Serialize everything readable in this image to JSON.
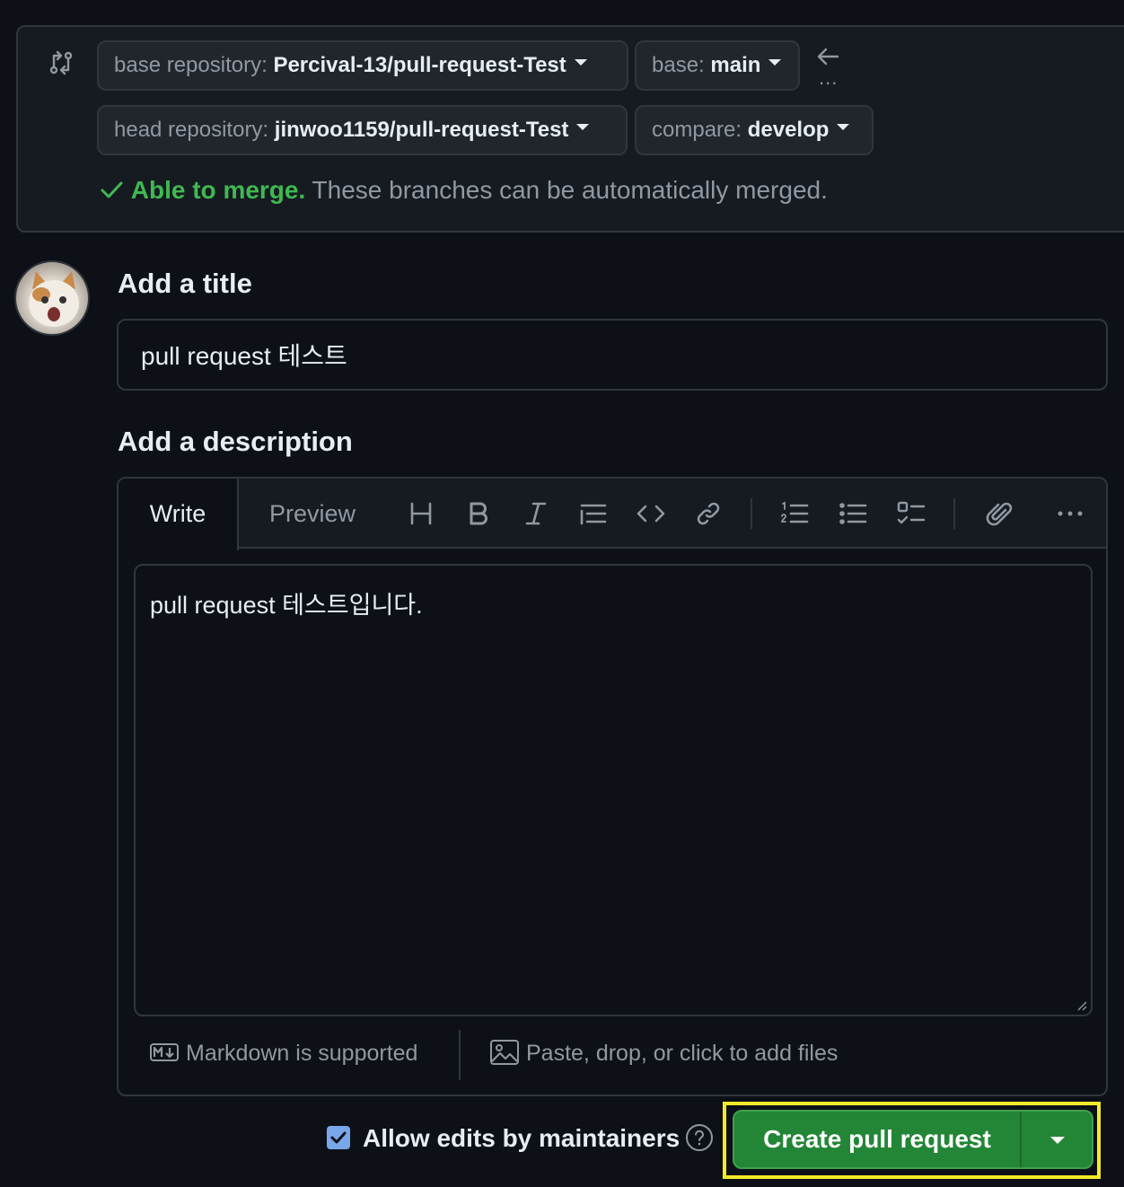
{
  "compare": {
    "base_repo_label": "base repository:",
    "base_repo_value": "Percival-13/pull-request-Test",
    "base_branch_label": "base:",
    "base_branch_value": "main",
    "head_repo_label": "head repository:",
    "head_repo_value": "jinwoo1159/pull-request-Test",
    "compare_branch_label": "compare:",
    "compare_branch_value": "develop",
    "dots": "...",
    "merge_status": "Able to merge.",
    "merge_message": "These branches can be automatically merged."
  },
  "form": {
    "title_heading": "Add a title",
    "title_value": "pull request 테스트",
    "description_heading": "Add a description",
    "tabs": {
      "write": "Write",
      "preview": "Preview"
    },
    "description_value": "pull request 테스트입니다.",
    "markdown_note": "Markdown is supported",
    "files_note": "Paste, drop, or click to add files"
  },
  "toolbar_icons": [
    "heading-icon",
    "bold-icon",
    "italic-icon",
    "quote-icon",
    "code-icon",
    "link-icon",
    "ordered-list-icon",
    "unordered-list-icon",
    "task-list-icon",
    "attach-icon",
    "more-icon"
  ],
  "actions": {
    "allow_edits_label": "Allow edits by maintainers",
    "allow_edits_checked": true,
    "create_label": "Create pull request"
  },
  "colors": {
    "background": "#0d1117",
    "success": "#3fb950",
    "primary_button": "#238636",
    "highlight": "#f5ea2a"
  }
}
